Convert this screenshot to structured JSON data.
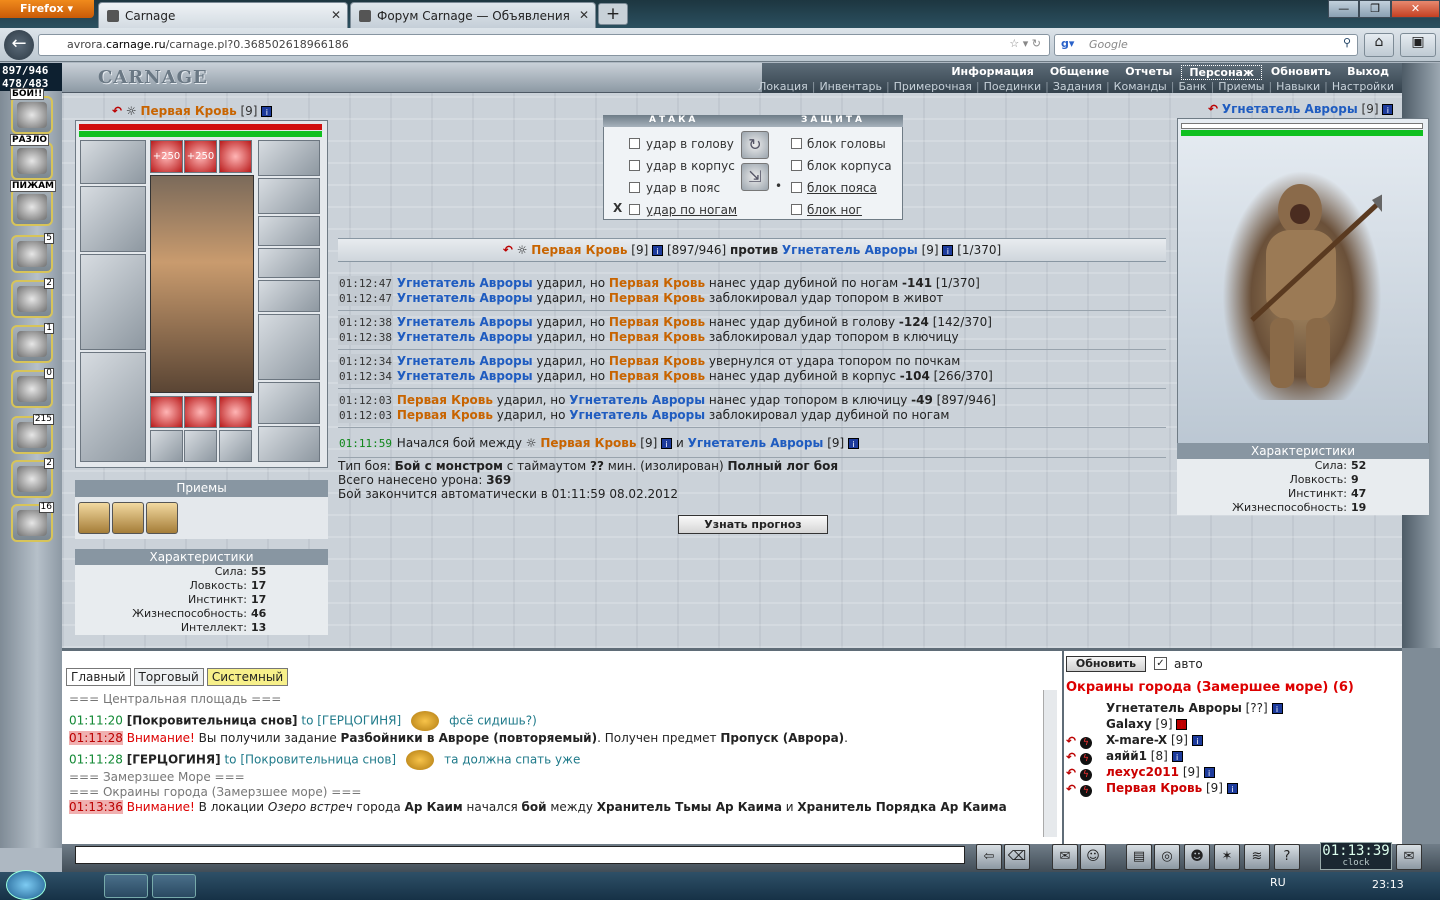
{
  "browser": {
    "app_button": "Firefox",
    "tabs": [
      {
        "label": "Carnage"
      },
      {
        "label": "Форум Carnage — Объявления"
      }
    ],
    "new_tab_symbol": "+",
    "url_prefix": "avrora.",
    "url_domain": "carnage.ru",
    "url_rest": "/carnage.pl?0.368502618966186",
    "search_placeholder": "Google",
    "window_controls": [
      "—",
      "❐",
      "✕"
    ]
  },
  "hud": {
    "hp": "897/946",
    "mp": "478/483",
    "logo": "CARNAGE"
  },
  "top_menu": {
    "main": [
      "Информация",
      "Общение",
      "Отчеты",
      "Персонаж",
      "Обновить",
      "Выход"
    ],
    "selected": "Персонаж",
    "sub": [
      "Локация",
      "Инвентарь",
      "Примерочная",
      "Поединки",
      "Задания",
      "Команды",
      "Банк",
      "Приемы",
      "Навыки",
      "Настройки"
    ]
  },
  "left_buttons": [
    {
      "label": "БОЙ!!",
      "count": ""
    },
    {
      "label": "РАЗЛО",
      "count": ""
    },
    {
      "label": "ПИЖАМ",
      "count": ""
    },
    {
      "label": "",
      "count": "5"
    },
    {
      "label": "",
      "count": "2"
    },
    {
      "label": "",
      "count": "1"
    },
    {
      "label": "",
      "count": "0"
    },
    {
      "label": "",
      "count": "215"
    },
    {
      "label": "",
      "count": "2"
    },
    {
      "label": "",
      "count": "16"
    }
  ],
  "player1": {
    "name": "Первая Кровь",
    "level": "[9]",
    "slots_bonus": [
      "+250",
      "+250"
    ],
    "techniques_title": "Приемы",
    "stats_title": "Характеристики",
    "stats": [
      {
        "k": "Сила:",
        "v": "55"
      },
      {
        "k": "Ловкость:",
        "v": "17"
      },
      {
        "k": "Инстинкт:",
        "v": "17"
      },
      {
        "k": "Жизнеспособность:",
        "v": "46"
      },
      {
        "k": "Интеллект:",
        "v": "13"
      }
    ]
  },
  "combat": {
    "attack_title": "АТАКА",
    "defense_title": "ЗАЩИТА",
    "attacks": [
      "удар в голову",
      "удар в корпус",
      "удар в пояс",
      "удар по ногам"
    ],
    "defenses": [
      "блок головы",
      "блок корпуса",
      "блок пояса",
      "блок ног"
    ],
    "attack_marker": "X",
    "defense_marker": "•",
    "vs_hp1": "[897/946]",
    "vs_word": "против",
    "vs_hp2": "[1/370]"
  },
  "log": [
    [
      {
        "t": "01:12:47",
        "a": "Угнетатель Авроры",
        "mid": " ударил, но ",
        "b": "Первая Кровь",
        "txt": " нанес удар дубиной по ногам ",
        "dmg": "-141",
        "hp": " [1/370]",
        "ac": "bl",
        "bc": "or"
      },
      {
        "t": "01:12:47",
        "a": "Угнетатель Авроры",
        "mid": " ударил, но ",
        "b": "Первая Кровь",
        "txt": " заблокировал удар топором в живот",
        "dmg": "",
        "hp": "",
        "ac": "bl",
        "bc": "or"
      }
    ],
    [
      {
        "t": "01:12:38",
        "a": "Угнетатель Авроры",
        "mid": " ударил, но ",
        "b": "Первая Кровь",
        "txt": " нанес удар дубиной в голову ",
        "dmg": "-124",
        "hp": " [142/370]",
        "ac": "bl",
        "bc": "or"
      },
      {
        "t": "01:12:38",
        "a": "Угнетатель Авроры",
        "mid": " ударил, но ",
        "b": "Первая Кровь",
        "txt": " заблокировал удар топором в ключицу",
        "dmg": "",
        "hp": "",
        "ac": "bl",
        "bc": "or"
      }
    ],
    [
      {
        "t": "01:12:34",
        "a": "Угнетатель Авроры",
        "mid": " ударил, но ",
        "b": "Первая Кровь",
        "txt": " увернулся от удара топором по почкам",
        "dmg": "",
        "hp": "",
        "ac": "bl",
        "bc": "or"
      },
      {
        "t": "01:12:34",
        "a": "Угнетатель Авроры",
        "mid": " ударил, но ",
        "b": "Первая Кровь",
        "txt": " нанес удар дубиной в корпус ",
        "dmg": "-104",
        "hp": " [266/370]",
        "ac": "bl",
        "bc": "or"
      }
    ],
    [
      {
        "t": "01:12:03",
        "a": "Первая Кровь",
        "mid": " ударил, но ",
        "b": "Угнетатель Авроры",
        "txt": " нанес удар топором в ключицу ",
        "dmg": "-49",
        "hp": " [897/946]",
        "ac": "or",
        "bc": "bl"
      },
      {
        "t": "01:12:03",
        "a": "Первая Кровь",
        "mid": " ударил, но ",
        "b": "Угнетатель Авроры",
        "txt": " заблокировал удар дубиной по ногам",
        "dmg": "",
        "hp": "",
        "ac": "or",
        "bc": "bl"
      }
    ]
  ],
  "log_start": {
    "t": "01:11:59",
    "txt": "Начался бой между",
    "a": "Первая Кровь",
    "lvl_a": "[9]",
    "and": "и",
    "b": "Угнетатель Авроры",
    "lvl_b": "[9]"
  },
  "fight_info": {
    "type_label": "Тип боя: ",
    "type_value": "Бой с монстром",
    "timeout_pre": " с таймаутом ",
    "timeout_value": "??",
    "timeout_post": " мин. (изолирован) ",
    "full_log": "Полный лог боя",
    "damage_label": "Всего нанесено урона: ",
    "damage_value": "369",
    "end_text": "Бой закончится автоматически в 01:11:59 08.02.2012",
    "forecast_button": "Узнать прогноз"
  },
  "player2": {
    "name": "Угнетатель Авроры",
    "level": "[9]",
    "stats_title": "Характеристики",
    "stats": [
      {
        "k": "Сила:",
        "v": "52"
      },
      {
        "k": "Ловкость:",
        "v": "9"
      },
      {
        "k": "Инстинкт:",
        "v": "47"
      },
      {
        "k": "Жизнеспособность:",
        "v": "19"
      }
    ]
  },
  "chat": {
    "tabs": [
      "Главный",
      "Торговый",
      "Системный"
    ],
    "lines": [
      {
        "kind": "gray",
        "text": "=== Центральная площадь ==="
      },
      {
        "kind": "msg",
        "t": "01:11:20",
        "from": "[Покровительница снов]",
        "to": "to [ГЕРЦОГИНЯ]",
        "msg": "фсё сидишь?)"
      },
      {
        "kind": "sys",
        "t": "01:11:28",
        "warn": "Внимание!",
        "pre": " Вы получили задание ",
        "b1": "Разбойники в Авроре (повторяемый)",
        "mid": ". Получен предмет ",
        "b2": "Пропуск (Аврора)",
        "post": "."
      },
      {
        "kind": "msg",
        "t": "01:11:28",
        "from": "[ГЕРЦОГИНЯ]",
        "to": "to [Покровительница снов]",
        "msg": "та должна спать уже"
      },
      {
        "kind": "gray",
        "text": "=== Замерзшее Море ==="
      },
      {
        "kind": "gray",
        "text": "=== Окраины города (Замерзшее море) ==="
      },
      {
        "kind": "sys2",
        "t": "01:13:36",
        "warn": "Внимание!",
        "pre": " В локации ",
        "it": "Озеро встреч",
        "mid": " города ",
        "b1": "Ар Каим",
        "mid2": " начался ",
        "u": "бой",
        "mid3": " между ",
        "b2": "Хранитель Тьмы Ар Каима",
        "and": " и ",
        "b3": "Хранитель Порядка Ар Каима"
      }
    ]
  },
  "online": {
    "refresh": "Обновить",
    "auto_label": "авто",
    "location": "Окраины города (Замершее море) (6)",
    "users": [
      {
        "name": "Угнетатель Авроры",
        "lvl": "[??]",
        "style": "dark",
        "icon": "none"
      },
      {
        "name": "Galaxy",
        "lvl": "[9]",
        "style": "dark",
        "icon": "none"
      },
      {
        "name": "X-mare-X",
        "lvl": "[9]",
        "style": "dark",
        "icon": "fight"
      },
      {
        "name": "аяйй1",
        "lvl": "[8]",
        "style": "dark",
        "icon": "fight"
      },
      {
        "name": "лехус2011",
        "lvl": "[9]",
        "style": "red",
        "icon": "fight"
      },
      {
        "name": "Первая Кровь",
        "lvl": "[9]",
        "style": "red",
        "icon": "fight"
      }
    ]
  },
  "clock": {
    "time": "01:13:39",
    "label": "clock"
  },
  "taskbar": {
    "lang": "RU",
    "time": "23:13"
  }
}
